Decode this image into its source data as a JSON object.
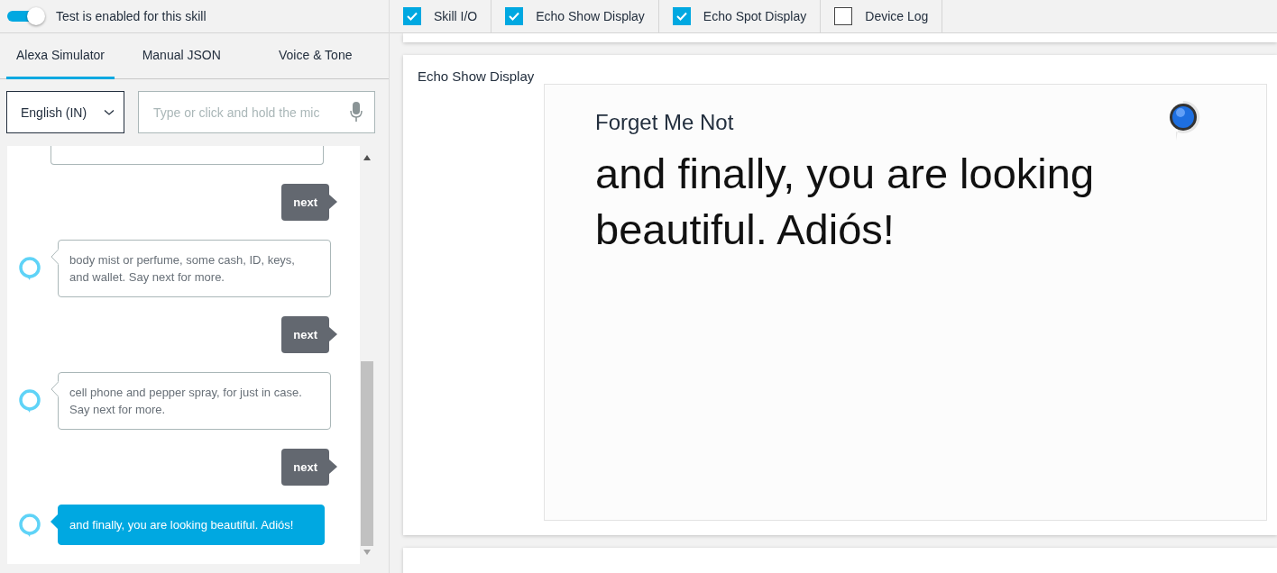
{
  "test_toggle": {
    "on": true,
    "label": "Test is enabled for this skill"
  },
  "tabs": [
    {
      "label": "Alexa Simulator",
      "selected": true
    },
    {
      "label": "Manual JSON",
      "selected": false
    },
    {
      "label": "Voice & Tone",
      "selected": false
    }
  ],
  "language": {
    "value": "English (IN)"
  },
  "utterance": {
    "placeholder": "Type or click and hold the mic"
  },
  "messages": [
    {
      "kind": "fragment"
    },
    {
      "kind": "user",
      "text": "next"
    },
    {
      "kind": "alexa",
      "active": false,
      "text": "body mist or perfume, some cash, ID, keys, and wallet. Say next for more."
    },
    {
      "kind": "user",
      "text": "next"
    },
    {
      "kind": "alexa",
      "active": false,
      "text": "cell phone and pepper spray, for just in case. Say next for more."
    },
    {
      "kind": "user",
      "text": "next"
    },
    {
      "kind": "alexa",
      "active": true,
      "text": "and finally, you are looking beautiful. Adiós!"
    }
  ],
  "panels": [
    {
      "label": "Skill I/O",
      "checked": true
    },
    {
      "label": "Echo Show Display",
      "checked": true
    },
    {
      "label": "Echo Spot Display",
      "checked": true
    },
    {
      "label": "Device Log",
      "checked": false
    }
  ],
  "echo_show": {
    "title": "Echo Show Display",
    "skill_title": "Forget Me Not",
    "body": "and finally, you are looking beautiful. Adiós!"
  }
}
